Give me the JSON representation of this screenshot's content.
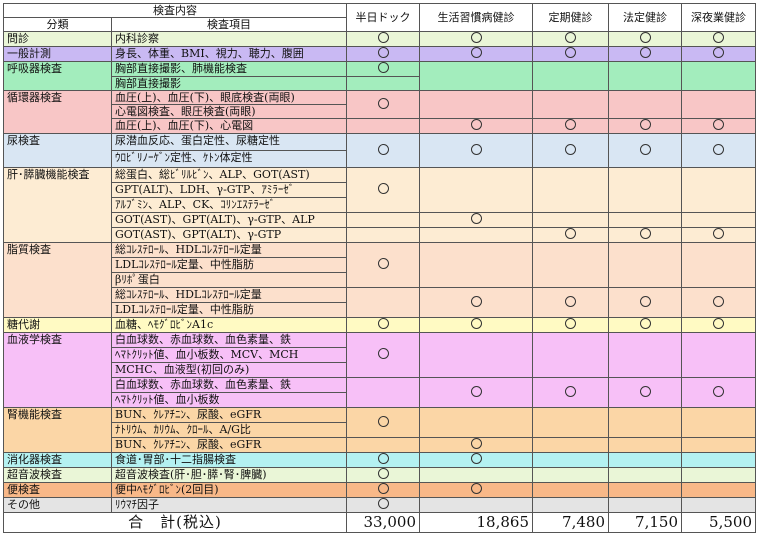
{
  "header": {
    "group_label": "検査内容",
    "col_category": "分類",
    "col_item": "検査項目",
    "courses": [
      "半日ドック",
      "生活習慣病健診",
      "定期健診",
      "法定健診",
      "深夜業健診"
    ]
  },
  "mark": "○",
  "rows": {
    "monshin": {
      "cat": "問診",
      "items": [
        "内科診察"
      ]
    },
    "ippan": {
      "cat": "一般計測",
      "items": [
        "身長、体重、BMI、視力、聴力、腹囲"
      ]
    },
    "kokyu": {
      "cat": "呼吸器検査",
      "items": [
        "胸部直接撮影、肺機能検査",
        "胸部直接撮影"
      ]
    },
    "junkan": {
      "cat": "循環器検査",
      "items": [
        "血圧(上)、血圧(下)、眼底検査(両眼)",
        "心電図検査、眼圧検査(両眼)",
        "血圧(上)、血圧(下)、心電図"
      ]
    },
    "nyo": {
      "cat": "尿検査",
      "items": [
        "尿潜血反応、蛋白定性、尿糖定性",
        "ｳﾛﾋﾞﾘﾉｰｹﾞﾝ定性、ｹﾄﾝ体定性"
      ]
    },
    "kan": {
      "cat": "肝･膵臓機能検査",
      "items": [
        "総蛋白、総ﾋﾞﾘﾙﾋﾞﾝ、ALP、GOT(AST)",
        "GPT(ALT)、LDH、γ-GTP、ｱﾐﾗｰｾﾞ",
        "ｱﾙﾌﾞﾐﾝ、ALP、CK、ｺﾘﾝｴｽﾃﾗｰｾﾞ",
        "GOT(AST)、GPT(ALT)、γ-GTP、ALP",
        "GOT(AST)、GPT(ALT)、γ-GTP"
      ]
    },
    "shishitsu": {
      "cat": "脂質検査",
      "items": [
        "総ｺﾚｽﾃﾛｰﾙ、HDLｺﾚｽﾃﾛｰﾙ定量",
        "LDLｺﾚｽﾃﾛｰﾙ定量、中性脂肪",
        "βﾘﾎﾟ蛋白",
        "総ｺﾚｽﾃﾛｰﾙ、HDLｺﾚｽﾃﾛｰﾙ定量",
        "LDLｺﾚｽﾃﾛｰﾙ定量、中性脂肪"
      ]
    },
    "tou": {
      "cat": "糖代謝",
      "items": [
        "血糖、ﾍﾓｸﾞﾛﾋﾞﾝA1c"
      ]
    },
    "ketsueki": {
      "cat": "血液学検査",
      "items": [
        "白血球数、赤血球数、血色素量、鉄",
        "ﾍﾏﾄｸﾘｯﾄ値、血小板数、MCV、MCH",
        "MCHC、血液型(初回のみ)",
        "白血球数、赤血球数、血色素量、鉄",
        "ﾍﾏﾄｸﾘｯﾄ値、血小板数"
      ]
    },
    "jin": {
      "cat": "腎機能検査",
      "items": [
        "BUN、ｸﾚｱﾁﾆﾝ、尿酸、eGFR",
        "ﾅﾄﾘｳﾑ、ｶﾘｳﾑ、ｸﾛｰﾙ、A/G比",
        "BUN、ｸﾚｱﾁﾆﾝ、尿酸、eGFR"
      ]
    },
    "shoka": {
      "cat": "消化器検査",
      "items": [
        "食道･胃部･十二指腸検査"
      ]
    },
    "cho": {
      "cat": "超音波検査",
      "items": [
        "超音波検査(肝･胆･膵･腎･脾臓)"
      ]
    },
    "ben": {
      "cat": "便検査",
      "items": [
        "便中ﾍﾓｸﾞﾛﾋﾞﾝ(2回目)"
      ]
    },
    "sonota": {
      "cat": "その他",
      "items": [
        "ﾘｳﾏﾁ因子"
      ]
    }
  },
  "total": {
    "label": "合　計(税込)",
    "values": [
      "33,000",
      "18,865",
      "7,480",
      "7,150",
      "5,500"
    ]
  },
  "colors": {
    "lavender": "#c9b9f3",
    "green": "#a3edbd",
    "pink": "#f8c6c6",
    "blue": "#d9e6f3",
    "peach": "#fdecd3",
    "tan": "#fce0cc",
    "yellow": "#fffac3",
    "magenta": "#f7c0f7",
    "orange": "#fbd6a6",
    "cyan": "#b4f1f1",
    "dark-orange": "#f8b888",
    "gray": "#e4e4e4"
  }
}
